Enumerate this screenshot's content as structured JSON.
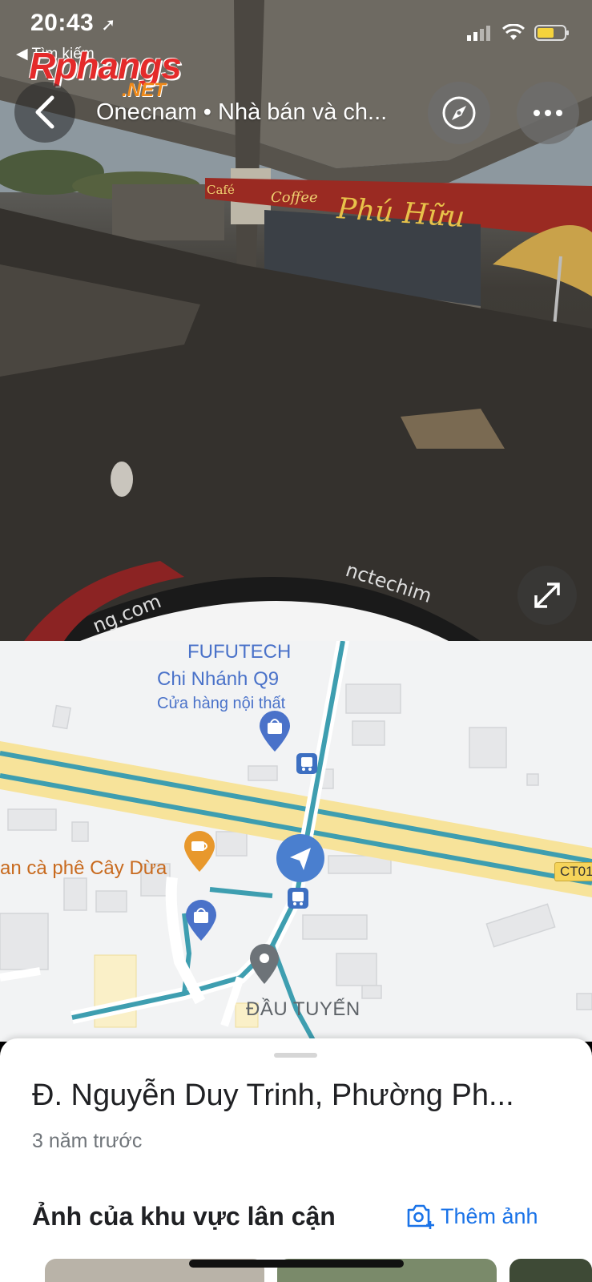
{
  "status_bar": {
    "time": "20:43",
    "back_label": "◀ Tìm kiếm",
    "icons": [
      "location-arrow-icon",
      "signal-icon",
      "wifi-icon",
      "battery-icon"
    ]
  },
  "watermark": {
    "main": "Rphangs",
    "sub": ".NET"
  },
  "streetview": {
    "title": "Onecnam • Nhà bán và ch...",
    "sign_text": "Phú Hữu",
    "sign_small": "Café",
    "sign_coffee": "Coffee",
    "lens_text_right": "nctechim",
    "lens_text_left": "ng.com",
    "icons": {
      "back": "back-arrow-icon",
      "compass": "compass-icon",
      "more": "more-dots-icon",
      "expand": "expand-icon"
    }
  },
  "map": {
    "poi_fufutech_name_line1": "FUFUTECH",
    "poi_fufutech_name_line2": "Chi Nhánh Q9",
    "poi_fufutech_category": "Cửa hàng nội thất",
    "poi_cafe": "an cà phê Cây Dừa",
    "area_label": "ĐẦU TUYẾN",
    "road_badge": "CT01"
  },
  "sheet": {
    "title": "Đ. Nguyễn Duy Trinh, Phường Ph...",
    "date": "3 năm trước",
    "nearby_heading": "Ảnh của khu vực lân cận",
    "add_photo_label": "Thêm ảnh"
  },
  "colors": {
    "accent_blue": "#1a73e8",
    "map_road_blue": "#3e9eb0",
    "map_highway_yellow": "#f7e39a",
    "poi_blue": "#4a72c9",
    "poi_orange": "#e8982c"
  }
}
